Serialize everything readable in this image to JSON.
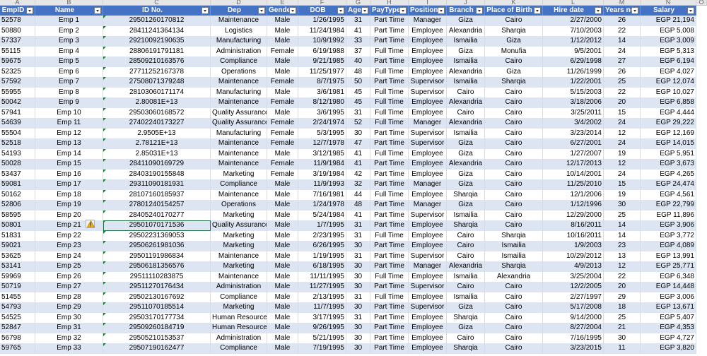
{
  "columns": [
    "A",
    "B",
    "C",
    "D",
    "E",
    "F",
    "G",
    "H",
    "I",
    "J",
    "K",
    "L",
    "M",
    "N",
    "O"
  ],
  "headers": [
    "EmpID",
    "Name",
    "ID No.",
    "Dep",
    "Gende",
    "DOB",
    "Age",
    "PayType",
    "Position",
    "Branch",
    "Place of Birth",
    "Hire date",
    "Years no",
    "Salary"
  ],
  "rows": [
    [
      "52578",
      "Emp 1",
      "29501260170812",
      "Maintenance",
      "Male",
      "1/26/1995",
      "31",
      "Part Time",
      "Manager",
      "Giza",
      "Cairo",
      "2/27/2000",
      "26",
      "EGP 21,194"
    ],
    [
      "50880",
      "Emp 2",
      "28411241364134",
      "Logistics",
      "Male",
      "11/24/1984",
      "41",
      "Part Time",
      "Employee",
      "Alexandria",
      "Sharqia",
      "7/10/2003",
      "22",
      "EGP 5,008"
    ],
    [
      "57337",
      "Emp 3",
      "29210092190635",
      "Manufacturing",
      "Male",
      "10/9/1992",
      "33",
      "Part Time",
      "Employee",
      "Ismailia",
      "Giza",
      "1/12/2012",
      "14",
      "EGP 3,009"
    ],
    [
      "55115",
      "Emp 4",
      "28806191791181",
      "Administration",
      "Female",
      "6/19/1988",
      "37",
      "Full Time",
      "Employee",
      "Giza",
      "Monufia",
      "9/5/2001",
      "24",
      "EGP 5,313"
    ],
    [
      "59675",
      "Emp 5",
      "28509210163576",
      "Compliance",
      "Male",
      "9/21/1985",
      "40",
      "Part Time",
      "Employee",
      "Ismailia",
      "Cairo",
      "6/29/1998",
      "27",
      "EGP 6,194"
    ],
    [
      "52325",
      "Emp 6",
      "27711252167378",
      "Operations",
      "Male",
      "11/25/1977",
      "48",
      "Full Time",
      "Employee",
      "Alexandria",
      "Giza",
      "11/26/1999",
      "26",
      "EGP 4,027"
    ],
    [
      "57592",
      "Emp 7",
      "27508071379248",
      "Maintenance",
      "Female",
      "8/7/1975",
      "50",
      "Part Time",
      "Supervisor",
      "Ismailia",
      "Sharqia",
      "1/22/2001",
      "25",
      "EGP 12,074"
    ],
    [
      "55955",
      "Emp 8",
      "28103060171174",
      "Manufacturing",
      "Male",
      "3/6/1981",
      "45",
      "Full Time",
      "Supervisor",
      "Cairo",
      "Cairo",
      "5/15/2003",
      "22",
      "EGP 10,027"
    ],
    [
      "50042",
      "Emp 9",
      "2.80081E+13",
      "Maintenance",
      "Female",
      "8/12/1980",
      "45",
      "Full Time",
      "Employee",
      "Alexandria",
      "Cairo",
      "3/18/2006",
      "20",
      "EGP 6,858"
    ],
    [
      "57941",
      "Emp 10",
      "29503060168572",
      "Quality Assurance",
      "Male",
      "3/6/1995",
      "31",
      "Full Time",
      "Employee",
      "Cairo",
      "Cairo",
      "3/25/2011",
      "15",
      "EGP 4,444"
    ],
    [
      "54639",
      "Emp 11",
      "27402240173227",
      "Quality Assurance",
      "Female",
      "2/24/1974",
      "52",
      "Full Time",
      "Manager",
      "Alexandria",
      "Cairo",
      "3/4/2002",
      "24",
      "EGP 29,222"
    ],
    [
      "55504",
      "Emp 12",
      "2.9505E+13",
      "Manufacturing",
      "Female",
      "5/3/1995",
      "30",
      "Part Time",
      "Supervisor",
      "Ismailia",
      "Cairo",
      "3/23/2014",
      "12",
      "EGP 12,169"
    ],
    [
      "52518",
      "Emp 13",
      "2.78121E+13",
      "Maintenance",
      "Female",
      "12/7/1978",
      "47",
      "Part Time",
      "Supervisor",
      "Giza",
      "Cairo",
      "6/27/2001",
      "24",
      "EGP 14,015"
    ],
    [
      "54193",
      "Emp 14",
      "2.85031E+13",
      "Maintenance",
      "Male",
      "3/12/1985",
      "41",
      "Full Time",
      "Employee",
      "Giza",
      "Cairo",
      "1/27/2007",
      "19",
      "EGP 5,951"
    ],
    [
      "50028",
      "Emp 15",
      "28411090169729",
      "Maintenance",
      "Female",
      "11/9/1984",
      "41",
      "Part Time",
      "Employee",
      "Alexandria",
      "Cairo",
      "12/17/2013",
      "12",
      "EGP 3,673"
    ],
    [
      "53437",
      "Emp 16",
      "28403190155848",
      "Marketing",
      "Female",
      "3/19/1984",
      "42",
      "Part Time",
      "Employee",
      "Giza",
      "Cairo",
      "10/14/2001",
      "24",
      "EGP 4,265"
    ],
    [
      "59081",
      "Emp 17",
      "29311090181931",
      "Compliance",
      "Male",
      "11/9/1993",
      "32",
      "Part Time",
      "Manager",
      "Giza",
      "Cairo",
      "11/25/2010",
      "15",
      "EGP 24,474"
    ],
    [
      "50162",
      "Emp 18",
      "28107160185937",
      "Maintenance",
      "Male",
      "7/16/1981",
      "44",
      "Full Time",
      "Employee",
      "Sharqia",
      "Cairo",
      "12/1/2006",
      "19",
      "EGP 4,561"
    ],
    [
      "52806",
      "Emp 19",
      "27801240154257",
      "Operations",
      "Male",
      "1/24/1978",
      "48",
      "Part Time",
      "Manager",
      "Giza",
      "Cairo",
      "1/12/1996",
      "30",
      "EGP 22,799"
    ],
    [
      "58595",
      "Emp 20",
      "28405240170277",
      "Marketing",
      "Male",
      "5/24/1984",
      "41",
      "Part Time",
      "Supervisor",
      "Ismailia",
      "Cairo",
      "12/29/2000",
      "25",
      "EGP 11,896"
    ],
    [
      "50801",
      "Emp 21",
      "29501070171536",
      "Quality Assurance",
      "Male",
      "1/7/1995",
      "31",
      "Part Time",
      "Employee",
      "Sharqia",
      "Cairo",
      "8/16/2011",
      "14",
      "EGP 3,906"
    ],
    [
      "51831",
      "Emp 22",
      "29502231369053",
      "Marketing",
      "Male",
      "2/23/1995",
      "31",
      "Full Time",
      "Employee",
      "Cairo",
      "Sharqia",
      "10/16/2011",
      "14",
      "EGP 3,772"
    ],
    [
      "59021",
      "Emp 23",
      "29506261981036",
      "Marketing",
      "Male",
      "6/26/1995",
      "30",
      "Part Time",
      "Employee",
      "Cairo",
      "Ismailia",
      "1/9/2003",
      "23",
      "EGP 4,089"
    ],
    [
      "53625",
      "Emp 24",
      "29501191986834",
      "Maintenance",
      "Male",
      "1/19/1995",
      "31",
      "Part Time",
      "Supervisor",
      "Cairo",
      "Ismailia",
      "10/29/2012",
      "13",
      "EGP 13,991"
    ],
    [
      "53141",
      "Emp 25",
      "29506181356576",
      "Marketing",
      "Male",
      "6/18/1995",
      "30",
      "Part Time",
      "Manager",
      "Alexandria",
      "Sharqia",
      "4/9/2013",
      "12",
      "EGP 25,771"
    ],
    [
      "59969",
      "Emp 26",
      "29511110283875",
      "Maintenance",
      "Male",
      "11/11/1995",
      "30",
      "Full Time",
      "Employee",
      "Ismailia",
      "Alexandria",
      "3/25/2004",
      "22",
      "EGP 6,348"
    ],
    [
      "50719",
      "Emp 27",
      "29511270176434",
      "Administration",
      "Male",
      "11/27/1995",
      "30",
      "Part Time",
      "Supervisor",
      "Cairo",
      "Cairo",
      "12/2/2005",
      "20",
      "EGP 14,448"
    ],
    [
      "51455",
      "Emp 28",
      "29502130167692",
      "Compliance",
      "Male",
      "2/13/1995",
      "31",
      "Full Time",
      "Employee",
      "Ismailia",
      "Cairo",
      "2/27/1997",
      "29",
      "EGP 3,006"
    ],
    [
      "54793",
      "Emp 29",
      "29511070185514",
      "Marketing",
      "Male",
      "11/7/1995",
      "30",
      "Part Time",
      "Supervisor",
      "Giza",
      "Cairo",
      "5/17/2008",
      "18",
      "EGP 13,671"
    ],
    [
      "54525",
      "Emp 30",
      "29503170177734",
      "Human Resources",
      "Male",
      "3/17/1995",
      "31",
      "Part Time",
      "Employee",
      "Sharqia",
      "Cairo",
      "9/14/2000",
      "25",
      "EGP 5,407"
    ],
    [
      "52847",
      "Emp 31",
      "29509260184719",
      "Human Resources",
      "Male",
      "9/26/1995",
      "30",
      "Part Time",
      "Employee",
      "Giza",
      "Cairo",
      "8/27/2004",
      "21",
      "EGP 4,353"
    ],
    [
      "56798",
      "Emp 32",
      "29505210153537",
      "Administration",
      "Male",
      "5/21/1995",
      "30",
      "Part Time",
      "Employee",
      "Cairo",
      "Cairo",
      "7/16/1995",
      "30",
      "EGP 4,727"
    ],
    [
      "59765",
      "Emp 33",
      "29507190162477",
      "Compliance",
      "Male",
      "7/19/1995",
      "30",
      "Part Time",
      "Employee",
      "Sharqia",
      "Cairo",
      "3/23/2015",
      "11",
      "EGP 3,820"
    ]
  ],
  "colors": {
    "header": "#4472c4",
    "band": "#dde4f2",
    "selection": "#217346"
  },
  "icons": {
    "warning": "warning-icon",
    "filter": "filter-dropdown-icon"
  }
}
